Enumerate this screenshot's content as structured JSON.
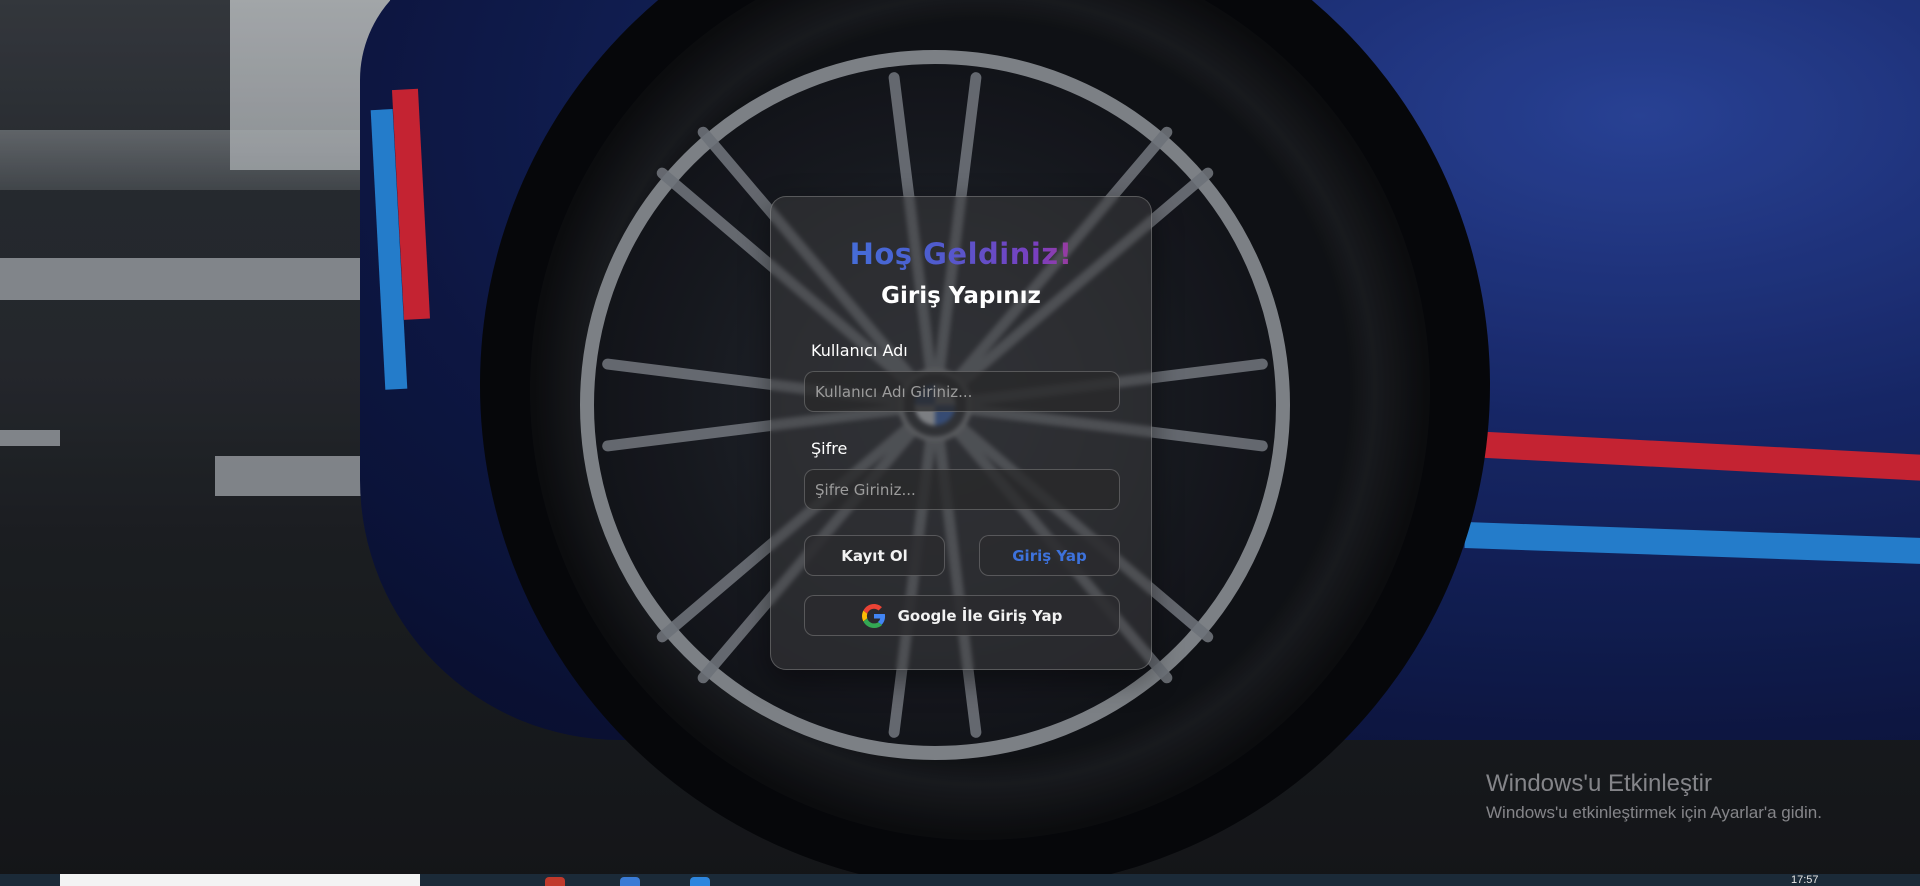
{
  "login": {
    "welcome": "Hoş Geldiniz!",
    "subtitle": "Giriş Yapınız",
    "username_label": "Kullanıcı Adı",
    "username_placeholder": "Kullanıcı Adı Giriniz...",
    "username_value": "",
    "password_label": "Şifre",
    "password_placeholder": "Şifre Giriniz...",
    "password_value": "",
    "register_button": "Kayıt Ol",
    "login_button": "Giriş Yap",
    "google_button": "Google İle Giriş Yap",
    "google_icon": "google-g-icon"
  },
  "colors": {
    "welcome_gradient": [
      "#3f7be0",
      "#4b5fd0",
      "#7a3fc0",
      "#e2344e"
    ],
    "login_button_text": "#3d72dc",
    "card_background": "rgba(58,58,60,0.55)"
  },
  "watermark": {
    "title": "Windows'u Etkinleştir",
    "subtitle": "Windows'u etkinleştirmek için Ayarlar'a gidin."
  },
  "taskbar": {
    "clock": "17:57"
  }
}
